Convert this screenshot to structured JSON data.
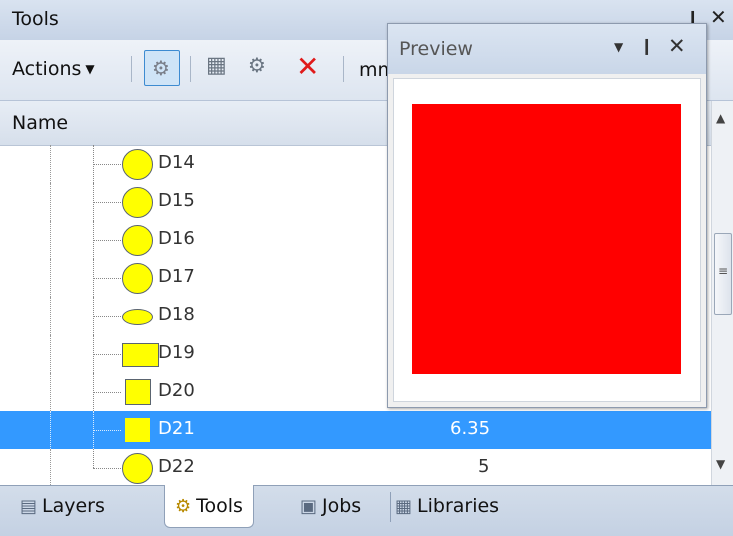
{
  "panel": {
    "title": "Tools"
  },
  "toolbar": {
    "actions_label": "Actions",
    "units_label": "mm"
  },
  "columns": {
    "name": "Name"
  },
  "rows": [
    {
      "label": "D14",
      "shape": "circle",
      "value": ""
    },
    {
      "label": "D15",
      "shape": "circle",
      "value": ""
    },
    {
      "label": "D16",
      "shape": "circle",
      "value": ""
    },
    {
      "label": "D17",
      "shape": "circle",
      "value": ""
    },
    {
      "label": "D18",
      "shape": "oval",
      "value": ""
    },
    {
      "label": "D19",
      "shape": "rectangle",
      "value": ""
    },
    {
      "label": "D20",
      "shape": "square",
      "value": ""
    },
    {
      "label": "D21",
      "shape": "square",
      "value": "6.35",
      "selected": true
    },
    {
      "label": "D22",
      "shape": "circle",
      "value": "5"
    }
  ],
  "tabs": [
    {
      "label": "Layers",
      "icon": "layers-icon"
    },
    {
      "label": "Tools",
      "icon": "gear-icon",
      "active": true
    },
    {
      "label": "Jobs",
      "icon": "jobs-icon"
    },
    {
      "label": "Libraries",
      "icon": "libraries-icon"
    }
  ],
  "preview": {
    "title": "Preview",
    "swatch_color": "#ff0000"
  },
  "colors": {
    "selection": "#3399ff",
    "aperture_fill": "#ffff00",
    "delete_icon": "#e01a1a"
  }
}
